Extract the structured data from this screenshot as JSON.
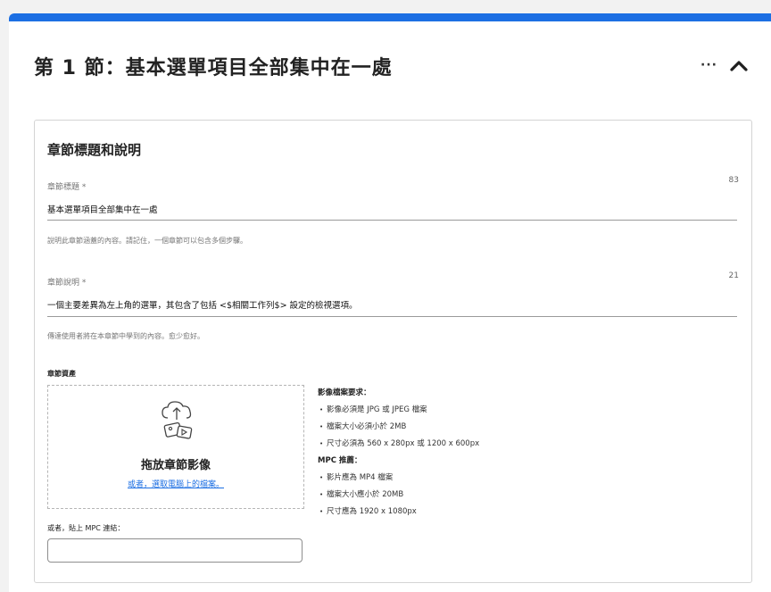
{
  "section": {
    "title": "第 1 節：基本選單項目全部集中在一處",
    "more_label": "···"
  },
  "panel": {
    "title": "章節標題和說明",
    "title_field": {
      "label": "章節標題 *",
      "count": "83",
      "value": "基本選單項目全部集中在一處",
      "help": "說明此章節涵蓋的內容。請記住，一個章節可以包含多個步驟。"
    },
    "desc_field": {
      "label": "章節說明 *",
      "count": "21",
      "value": "一個主要差異為左上角的選單，其包含了包括 <$相關工作列$> 設定的檢視選項。",
      "help": "傳達使用者將在本章節中學到的內容。愈少愈好。"
    },
    "assets": {
      "label": "章節資產",
      "drop_title": "拖放章節影像",
      "drop_link": "或者，選取電腦上的檔案。",
      "image_req_title": "影像檔案要求：",
      "image_reqs": [
        "影像必須是 JPG 或 JPEG 檔案",
        "檔案大小必須小於 2MB",
        "尺寸必須為 560 x 280px 或 1200 x 600px"
      ],
      "mpc_title": "MPC 推薦：",
      "mpc_reqs": [
        "影片應為 MP4 檔案",
        "檔案大小應小於 20MB",
        "尺寸應為 1920 x 1080px"
      ],
      "paste_label": "或者，貼上 MPC 連結：",
      "paste_value": ""
    }
  },
  "colors": {
    "accent": "#1c6fe3",
    "background": "#f2f2f2"
  }
}
